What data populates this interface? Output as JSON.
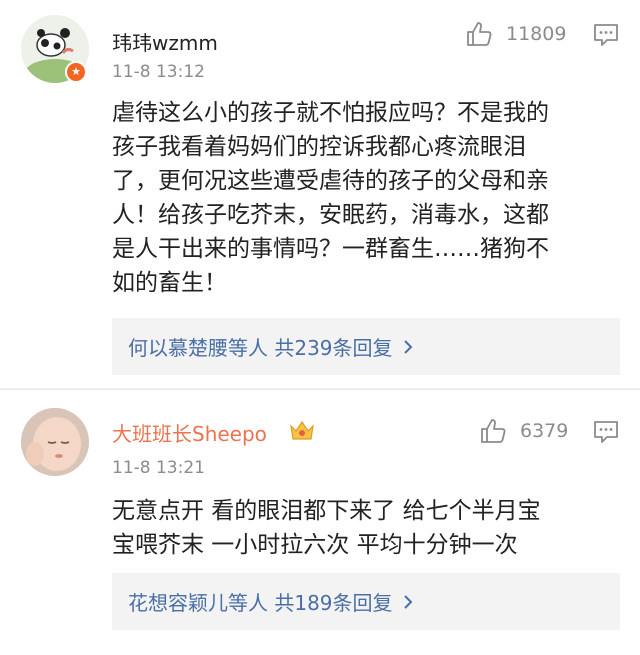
{
  "comments": [
    {
      "username": "玮玮wzmm",
      "time": "11-8 13:12",
      "likes": "11809",
      "content_lines": [
        "虐待这么小的孩子就不怕报应吗？不是我的",
        "孩子我看着妈妈们的控诉我都心疼流眼泪",
        "了，更何况这些遭受虐待的孩子的父母和亲",
        "人！给孩子吃芥末，安眠药，消毒水，这都",
        "是人干出来的事情吗？一群畜生……猪狗不",
        "如的畜生！"
      ],
      "replies_summary": "何以慕楚腰等人 共239条回复",
      "icons": {
        "avatar": "avatar-image",
        "badge": "verified-badge-icon",
        "like": "thumbs-up-icon",
        "reply": "comment-icon",
        "more": "chevron-right-icon"
      }
    },
    {
      "username": "大班班长Sheepo",
      "time": "11-8 13:21",
      "likes": "6379",
      "content_lines": [
        "无意点开 看的眼泪都下来了 给七个半月宝",
        "宝喂芥末 一小时拉六次 平均十分钟一次"
      ],
      "replies_summary": "花想容颖儿等人 共189条回复",
      "icons": {
        "avatar": "avatar-image",
        "vip": "crown-vip-icon",
        "like": "thumbs-up-icon",
        "reply": "comment-icon",
        "more": "chevron-right-icon"
      }
    }
  ],
  "colors": {
    "username_vip": "#eb7350",
    "link": "#4a6fa5",
    "meta": "#8b8b8b",
    "reply_bg": "#f3f3f3",
    "badge": "#f26522"
  }
}
